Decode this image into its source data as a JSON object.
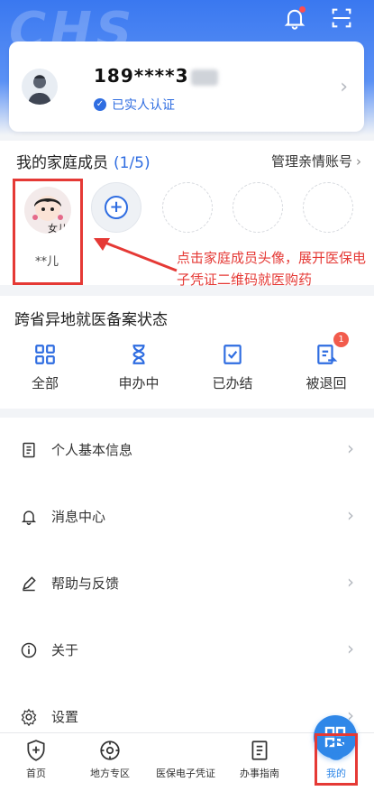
{
  "header": {
    "watermark": "CHS",
    "notification_icon": "bell-icon",
    "scan_icon": "scan-icon"
  },
  "profile": {
    "phone": "189****3",
    "verified_label": "已实人认证"
  },
  "family": {
    "title": "我的家庭成员",
    "count": "(1/5)",
    "manage_label": "管理亲情账号",
    "member_tag": "女儿",
    "member_name": "**儿"
  },
  "annotation": {
    "text": "点击家庭成员头像，展开医保电子凭证二维码就医购药",
    "color": "#e53935"
  },
  "filing": {
    "title": "跨省异地就医备案状态",
    "items": [
      {
        "label": "全部",
        "icon": "grid-icon"
      },
      {
        "label": "申办中",
        "icon": "hourglass-icon"
      },
      {
        "label": "已办结",
        "icon": "check-doc-icon"
      },
      {
        "label": "被退回",
        "icon": "return-doc-icon",
        "badge": "1"
      }
    ]
  },
  "menu": {
    "items": [
      {
        "label": "个人基本信息",
        "icon": "document-icon"
      },
      {
        "label": "消息中心",
        "icon": "bell-icon"
      },
      {
        "label": "帮助与反馈",
        "icon": "pen-icon"
      },
      {
        "label": "关于",
        "icon": "info-icon"
      },
      {
        "label": "设置",
        "icon": "gear-icon"
      }
    ]
  },
  "nav": {
    "items": [
      {
        "label": "首页",
        "icon": "shield-icon"
      },
      {
        "label": "地方专区",
        "icon": "compass-icon"
      },
      {
        "label": "医保电子凭证",
        "icon": "qr-icon"
      },
      {
        "label": "办事指南",
        "icon": "guide-icon"
      },
      {
        "label": "我的",
        "icon": "smile-icon"
      }
    ],
    "active": "我的",
    "accent": "#2f87e8"
  }
}
